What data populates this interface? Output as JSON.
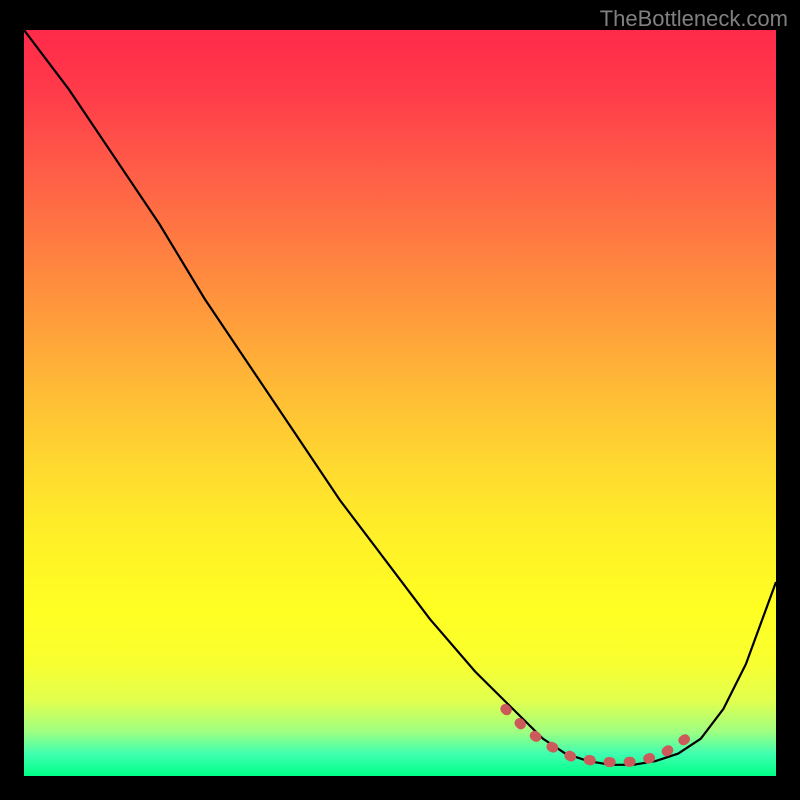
{
  "attribution": "TheBottleneck.com",
  "chart_data": {
    "type": "line",
    "title": "",
    "xlabel": "",
    "ylabel": "",
    "xlim": [
      0,
      100
    ],
    "ylim": [
      0,
      100
    ],
    "series": [
      {
        "name": "curve",
        "color": "#000000",
        "x": [
          0,
          6,
          12,
          18,
          24,
          30,
          36,
          42,
          48,
          54,
          60,
          65,
          69,
          72,
          75,
          78,
          81,
          84,
          87,
          90,
          93,
          96,
          100
        ],
        "y": [
          100,
          92,
          83,
          74,
          64,
          55,
          46,
          37,
          29,
          21,
          14,
          9,
          5,
          3,
          2,
          1.5,
          1.5,
          2,
          3,
          5,
          9,
          15,
          26
        ]
      },
      {
        "name": "highlight",
        "color": "#cc5a5a",
        "style": "dashed-thick",
        "x": [
          64,
          67,
          70,
          73,
          76,
          79,
          82,
          85,
          88
        ],
        "y": [
          9,
          6,
          4,
          2.5,
          2,
          1.8,
          2,
          3,
          5
        ]
      }
    ],
    "gradient_stops": [
      {
        "pos": 0,
        "color": "#ff2a4a"
      },
      {
        "pos": 50,
        "color": "#ffd830"
      },
      {
        "pos": 80,
        "color": "#ffff22"
      },
      {
        "pos": 100,
        "color": "#00ff88"
      }
    ]
  }
}
